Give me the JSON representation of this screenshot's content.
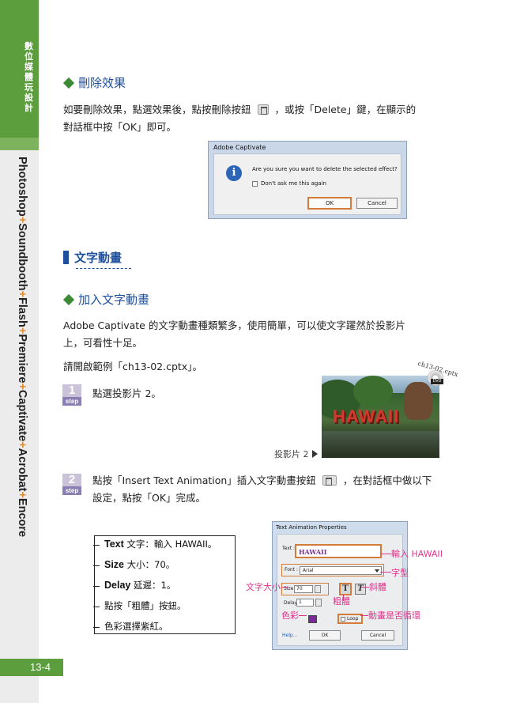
{
  "sidebar": {
    "top_text": "數位媒體玩設計",
    "products": [
      "Photoshop",
      "Soundbooth",
      "Flash",
      "Premiere",
      "Captivate",
      "Acrobat",
      "Encore"
    ],
    "separator": "+",
    "page_number": "13-4"
  },
  "section_delete": {
    "heading": "刪除效果",
    "para_before": "如要刪除效果，點選效果後，點按刪除按鈕",
    "para_after": "，或按「Delete」鍵，在顯示的",
    "para_line2": "對話框中按「OK」即可。"
  },
  "dialog_delete": {
    "title": "Adobe Captivate",
    "message": "Are you sure you want to delete the selected effect?",
    "checkbox_label": "Don't ask me this again",
    "ok_label": "OK",
    "cancel_label": "Cancel"
  },
  "section_text_anim": {
    "title": "文字動畫",
    "heading": "加入文字動畫",
    "para1_line1": "Adobe Captivate 的文字動畫種類繁多，使用簡單，可以使文字躍然於投影片",
    "para1_line2": "上，可看性十足。",
    "para2": "請開啟範例「ch13-02.cptx」。"
  },
  "step1": {
    "num": "1",
    "badge": "step",
    "text": "點選投影片 2。"
  },
  "photo": {
    "sign_text": "HAWAII",
    "caption": "投影片 2",
    "cd_label": "ch13-02.cptx",
    "dvd_label": "DVD"
  },
  "step2": {
    "num": "2",
    "badge": "step",
    "text_before": "點按「Insert Text Animation」插入文字動畫按鈕",
    "text_after": "，在對話框中做以下",
    "text_line2": "設定，點按「OK」完成。"
  },
  "instructions": [
    {
      "label": "Text",
      "text": " 文字：輸入 HAWAII。"
    },
    {
      "label": "Size",
      "text": " 大小：70。"
    },
    {
      "label": "Delay",
      "text": " 延遲：1。"
    },
    {
      "label": "",
      "text": "點按「粗體」按鈕。"
    },
    {
      "label": "",
      "text": "色彩選擇紫紅。"
    }
  ],
  "dialog_text_anim": {
    "title": "Text Animation Properties",
    "text_label": "Text :",
    "text_value": "HAWAII",
    "font_label": "Font :",
    "font_value": "Arial",
    "size_label": "Size :",
    "size_value": "70",
    "bold_glyph": "T",
    "italic_glyph": "T",
    "delay_label": "Delay :",
    "delay_value": "1",
    "loop_label": "Loop",
    "help_label": "Help...",
    "ok_label": "OK",
    "cancel_label": "Cancel",
    "color_value": "#7b2a9a"
  },
  "callouts": {
    "text": "輸入 HAWAII",
    "font": "字型",
    "size": "文字大小",
    "italic": "斜體",
    "bold": "粗體",
    "color": "色彩",
    "loop": "動畫是否循環"
  },
  "colors": {
    "brand_green": "#5c9d3e",
    "heading_blue": "#1d4f9c",
    "callout_pink": "#e0348c",
    "highlight_orange": "#d47b3a"
  }
}
